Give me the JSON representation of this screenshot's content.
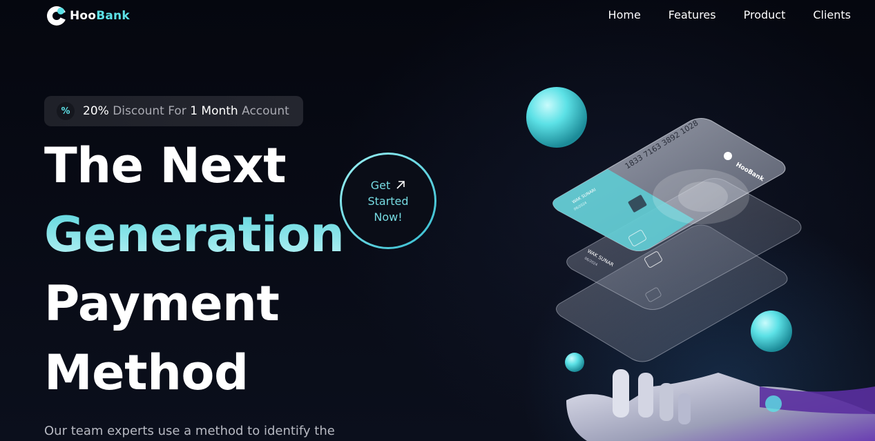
{
  "brand": {
    "name_part1": "Hoo",
    "name_part2": "Bank",
    "card_logo": "HooBank"
  },
  "nav": {
    "items": [
      {
        "label": "Home"
      },
      {
        "label": "Features"
      },
      {
        "label": "Product"
      },
      {
        "label": "Clients"
      }
    ]
  },
  "badge": {
    "icon": "discount-icon",
    "percent": "20%",
    "text1": " Discount For ",
    "duration": "1 Month",
    "text2": " Account"
  },
  "hero": {
    "line1": "The Next",
    "line2": "Generation",
    "line3": "Payment",
    "line4": "Method",
    "subtext": "Our team experts use a method to identify the"
  },
  "cta": {
    "line1": "Get",
    "line2": "Started",
    "line3": "Now!",
    "icon": "arrow-up-right-icon"
  },
  "cards": {
    "number": "1833 7163 3892 1028",
    "holder": "WAK SUNARI",
    "holder_short": "WAK SUNAR",
    "expiry": "06/2024"
  },
  "colors": {
    "accent": "#5ce1e6",
    "background": "#00040f"
  }
}
